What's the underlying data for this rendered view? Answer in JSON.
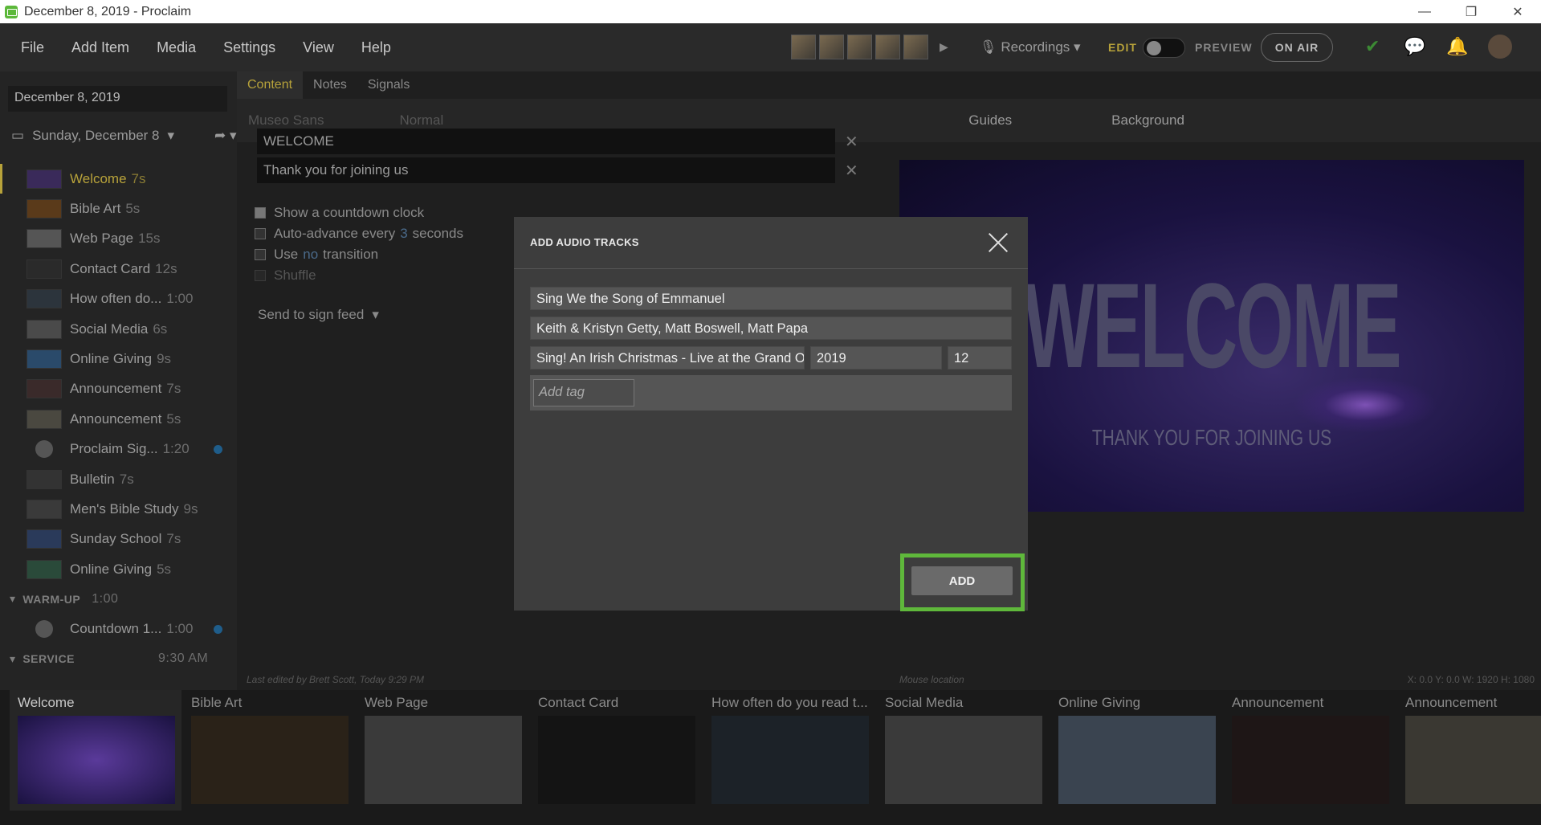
{
  "window": {
    "title": "December 8, 2019 - Proclaim",
    "controls": [
      "—",
      "❐",
      "✕"
    ]
  },
  "menu": [
    "File",
    "Add Item",
    "Media",
    "Settings",
    "View",
    "Help"
  ],
  "topbar": {
    "recordings_label": "Recordings",
    "edit_label": "EDIT",
    "preview_label": "PREVIEW",
    "onair_label": "ON AIR",
    "accent": "#b7a23a"
  },
  "left": {
    "date_value": "December 8, 2019",
    "day_label": "Sunday, December 8",
    "items": [
      {
        "title": "Welcome",
        "duration": "7s",
        "active": true
      },
      {
        "title": "Bible Art",
        "duration": "5s"
      },
      {
        "title": "Web Page",
        "duration": "15s"
      },
      {
        "title": "Contact Card",
        "duration": "12s"
      },
      {
        "title": "How often do...",
        "duration": "1:00"
      },
      {
        "title": "Social Media",
        "duration": "6s"
      },
      {
        "title": "Online Giving",
        "duration": "9s"
      },
      {
        "title": "Announcement",
        "duration": "7s"
      },
      {
        "title": "Announcement",
        "duration": "5s"
      },
      {
        "title": "Proclaim Sig...",
        "duration": "1:20"
      },
      {
        "title": "Bulletin",
        "duration": "7s"
      },
      {
        "title": "Men's Bible Study",
        "duration": "9s"
      },
      {
        "title": "Sunday School",
        "duration": "7s"
      },
      {
        "title": "Online Giving",
        "duration": "5s"
      }
    ],
    "warmup": {
      "label": "WARM-UP",
      "time": "1:00",
      "item_title": "Countdown 1...",
      "item_duration": "1:00"
    },
    "service": {
      "label": "SERVICE",
      "time": "9:30 AM"
    }
  },
  "editor": {
    "tabs": [
      "Content",
      "Notes",
      "Signals"
    ],
    "font_name": "Museo Sans",
    "font_style": "Normal",
    "guides": "Guides",
    "background": "Background",
    "field1": "WELCOME",
    "field2": "Thank you for joining us",
    "opt_countdown": "Show a countdown clock",
    "opt_auto_pre": "Auto-advance every",
    "opt_auto_num": "3",
    "opt_auto_post": "seconds",
    "opt_use_pre": "Use",
    "opt_use_mid": "no",
    "opt_use_post": "transition",
    "opt_shuffle": "Shuffle",
    "send_feed": "Send to sign feed",
    "preview_big": "WELCOME",
    "preview_small": "THANK YOU FOR JOINING US",
    "last_edited": "Last edited by Brett Scott, Today 9:29 PM",
    "mouse_location": "Mouse location",
    "coords": "X: 0.0  Y: 0.0  W: 1920  H: 1080"
  },
  "strip": [
    "Welcome",
    "Bible Art",
    "Web Page",
    "Contact Card",
    "How often do you read t...",
    "Social Media",
    "Online Giving",
    "Announcement",
    "Announcement"
  ],
  "modal": {
    "title": "ADD AUDIO TRACKS",
    "song_title": "Sing We the Song of Emmanuel",
    "artists": "Keith & Kristyn Getty, Matt Boswell, Matt Papa",
    "album": "Sing! An Irish Christmas - Live at the Grand Ol",
    "year": "2019",
    "track": "12",
    "tag_placeholder": "Add tag",
    "add_label": "ADD",
    "highlight_color": "#5fb83b"
  }
}
